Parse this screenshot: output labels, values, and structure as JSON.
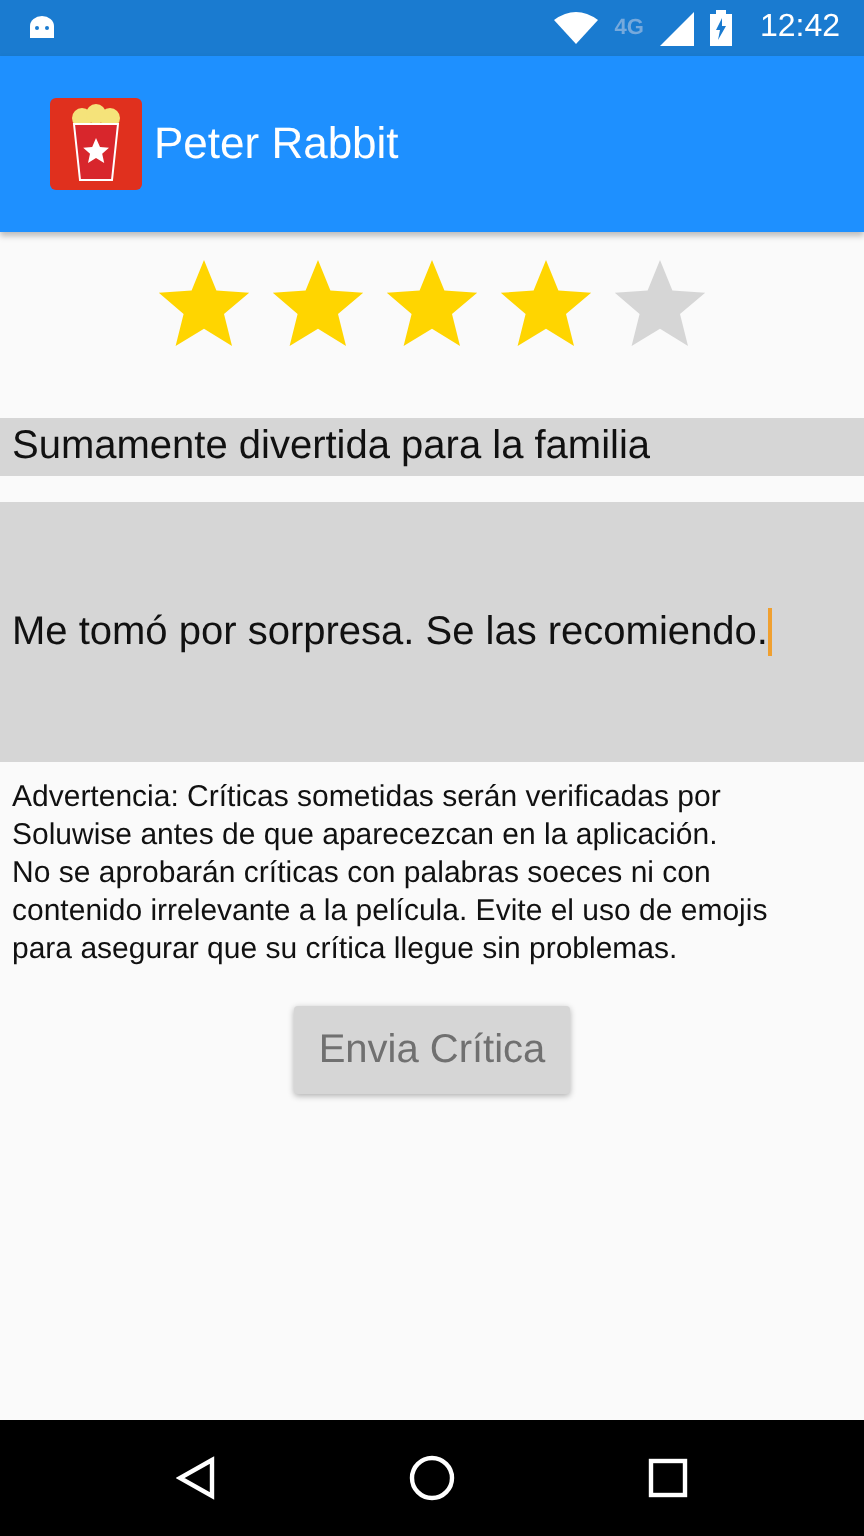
{
  "status_bar": {
    "network": "4G",
    "time": "12:42"
  },
  "app_bar": {
    "title": "Peter Rabbit"
  },
  "rating": {
    "stars": 4
  },
  "review_title": {
    "value": "Sumamente divertida para la familia"
  },
  "review_body": {
    "value": "Me tomó por sorpresa. Se las recomiendo.",
    "focused": true
  },
  "warning": "Advertencia: Críticas sometidas serán verificadas por\nSoluwise antes de que aparecezcan en la aplicación.\nNo se aprobarán críticas con palabras soeces ni con\ncontenido irrelevante a la película. Evite el uso de emojis\npara asegurar que su crítica llegue sin problemas.",
  "submit_button": {
    "label": "Envia Crítica",
    "disabled": true
  }
}
